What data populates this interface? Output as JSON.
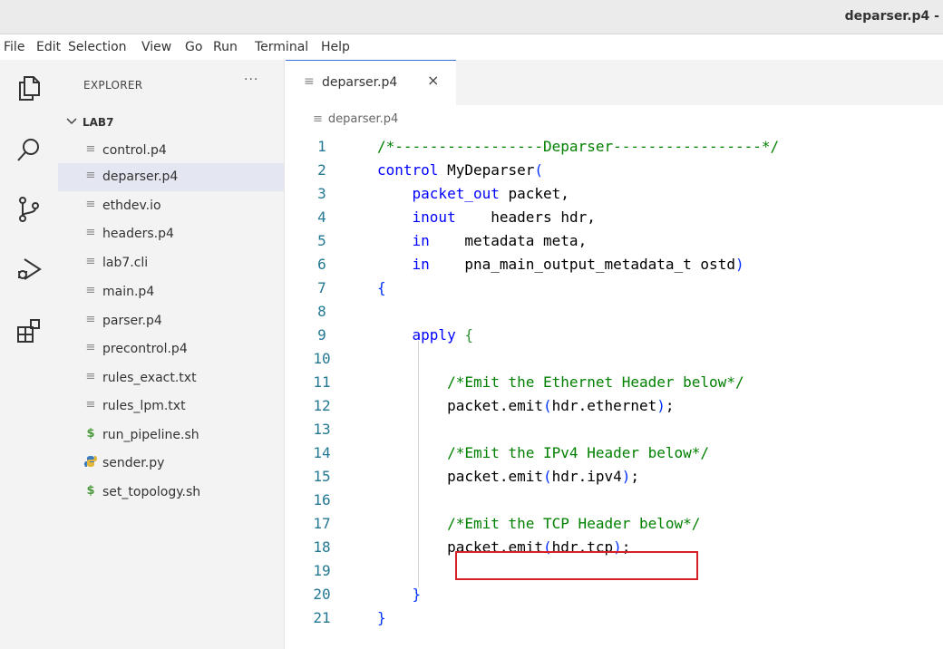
{
  "window": {
    "title": "deparser.p4 -"
  },
  "menu": [
    "File",
    "Edit",
    "Selection",
    "View",
    "Go",
    "Run",
    "Terminal",
    "Help"
  ],
  "activity_icons": [
    "explorer-icon",
    "search-icon",
    "source-control-icon",
    "run-debug-icon",
    "extensions-icon"
  ],
  "sidebar": {
    "header": "EXPLORER",
    "more": "···",
    "folder": "LAB7",
    "files": [
      {
        "name": "control.p4",
        "icon": "text-file-icon"
      },
      {
        "name": "deparser.p4",
        "icon": "text-file-icon",
        "selected": true
      },
      {
        "name": "ethdev.io",
        "icon": "text-file-icon"
      },
      {
        "name": "headers.p4",
        "icon": "text-file-icon"
      },
      {
        "name": "lab7.cli",
        "icon": "text-file-icon"
      },
      {
        "name": "main.p4",
        "icon": "text-file-icon"
      },
      {
        "name": "parser.p4",
        "icon": "text-file-icon"
      },
      {
        "name": "precontrol.p4",
        "icon": "text-file-icon"
      },
      {
        "name": "rules_exact.txt",
        "icon": "text-file-icon"
      },
      {
        "name": "rules_lpm.txt",
        "icon": "text-file-icon"
      },
      {
        "name": "run_pipeline.sh",
        "icon": "shell-file-icon"
      },
      {
        "name": "sender.py",
        "icon": "python-file-icon"
      },
      {
        "name": "set_topology.sh",
        "icon": "shell-file-icon"
      }
    ]
  },
  "editor": {
    "tab": {
      "label": "deparser.p4",
      "close": "×"
    },
    "breadcrumb": "deparser.p4",
    "lines": [
      {
        "n": "1",
        "text": "/*-----------------Deparser-----------------*/"
      },
      {
        "n": "2",
        "text": "control MyDeparser("
      },
      {
        "n": "3",
        "text": "    packet_out packet,"
      },
      {
        "n": "4",
        "text": "    inout    headers hdr,"
      },
      {
        "n": "5",
        "text": "    in    metadata meta,"
      },
      {
        "n": "6",
        "text": "    in    pna_main_output_metadata_t ostd)"
      },
      {
        "n": "7",
        "text": "{"
      },
      {
        "n": "8",
        "text": ""
      },
      {
        "n": "9",
        "text": "    apply {"
      },
      {
        "n": "10",
        "text": ""
      },
      {
        "n": "11",
        "text": "        /*Emit the Ethernet Header below*/"
      },
      {
        "n": "12",
        "text": "        packet.emit(hdr.ethernet);"
      },
      {
        "n": "13",
        "text": ""
      },
      {
        "n": "14",
        "text": "        /*Emit the IPv4 Header below*/"
      },
      {
        "n": "15",
        "text": "        packet.emit(hdr.ipv4);"
      },
      {
        "n": "16",
        "text": ""
      },
      {
        "n": "17",
        "text": "        /*Emit the TCP Header below*/"
      },
      {
        "n": "18",
        "text": "        packet.emit(hdr.tcp);"
      },
      {
        "n": "19",
        "text": ""
      },
      {
        "n": "20",
        "text": "    }"
      },
      {
        "n": "21",
        "text": "}"
      }
    ],
    "highlighted_line": "18"
  },
  "colors": {
    "keyword": "#0000ff",
    "comment": "#008000",
    "line_number": "#237893",
    "highlight_box": "#d91f26",
    "selected_row": "#e4e6f1"
  }
}
